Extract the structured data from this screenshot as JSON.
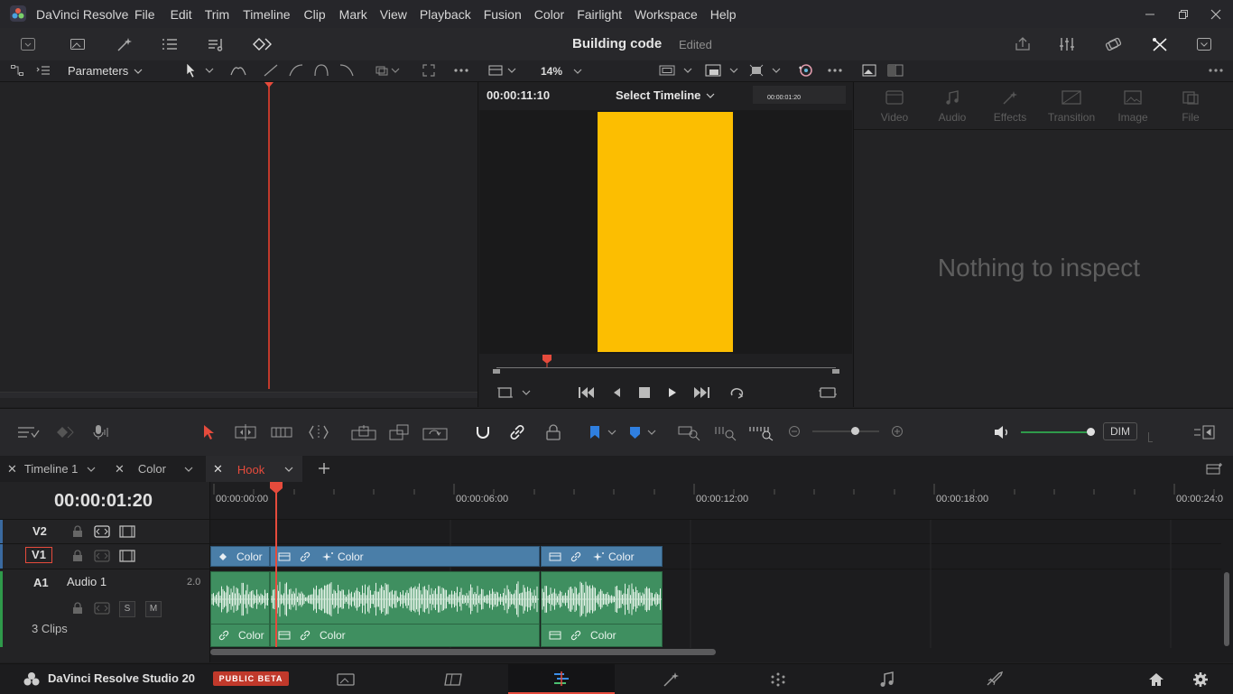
{
  "app": {
    "name": "DaVinci Resolve",
    "menu": [
      "File",
      "Edit",
      "Trim",
      "Timeline",
      "Clip",
      "Mark",
      "View",
      "Playback",
      "Fusion",
      "Color",
      "Fairlight",
      "Workspace",
      "Help"
    ]
  },
  "project": {
    "title": "Building code",
    "status": "Edited"
  },
  "left_panel": {
    "dropdown": "Parameters"
  },
  "viewer": {
    "zoom": "14%",
    "timecode": "00:00:11:10",
    "timeline_select": "Select Timeline",
    "mini_timecode": "00:00:01:20",
    "frame_color": "#fcbe01",
    "playhead_progress": 0.15
  },
  "inspector": {
    "tabs": [
      "Video",
      "Audio",
      "Effects",
      "Transition",
      "Image",
      "File"
    ],
    "empty_message": "Nothing to inspect"
  },
  "edit_toolbar": {
    "dim_label": "DIM"
  },
  "timeline_tabs": [
    {
      "label": "Timeline 1",
      "active": false
    },
    {
      "label": "Color",
      "active": false
    },
    {
      "label": "Hook",
      "active": true
    }
  ],
  "timeline": {
    "timecode": "00:00:01:20",
    "ruler": [
      "00:00:00:00",
      "00:00:06:00",
      "00:00:12:00",
      "00:00:18:00",
      "00:00:24:0"
    ],
    "tracks": {
      "v2": "V2",
      "v1": "V1",
      "a1": "A1",
      "a1_name": "Audio 1",
      "a1_channels": "2.0",
      "a1_clips": "3 Clips",
      "solo": "S",
      "mute": "M"
    },
    "video_clips": [
      "Color",
      "Color",
      "Color"
    ],
    "audio_clips": [
      "Color",
      "Color",
      "Color"
    ]
  },
  "footer": {
    "brand": "DaVinci Resolve Studio 20",
    "badge": "PUBLIC BETA"
  },
  "colors": {
    "accent_red": "#e64b3c",
    "clip_video": "#4a7ea8",
    "clip_audio": "#3f8f60"
  }
}
